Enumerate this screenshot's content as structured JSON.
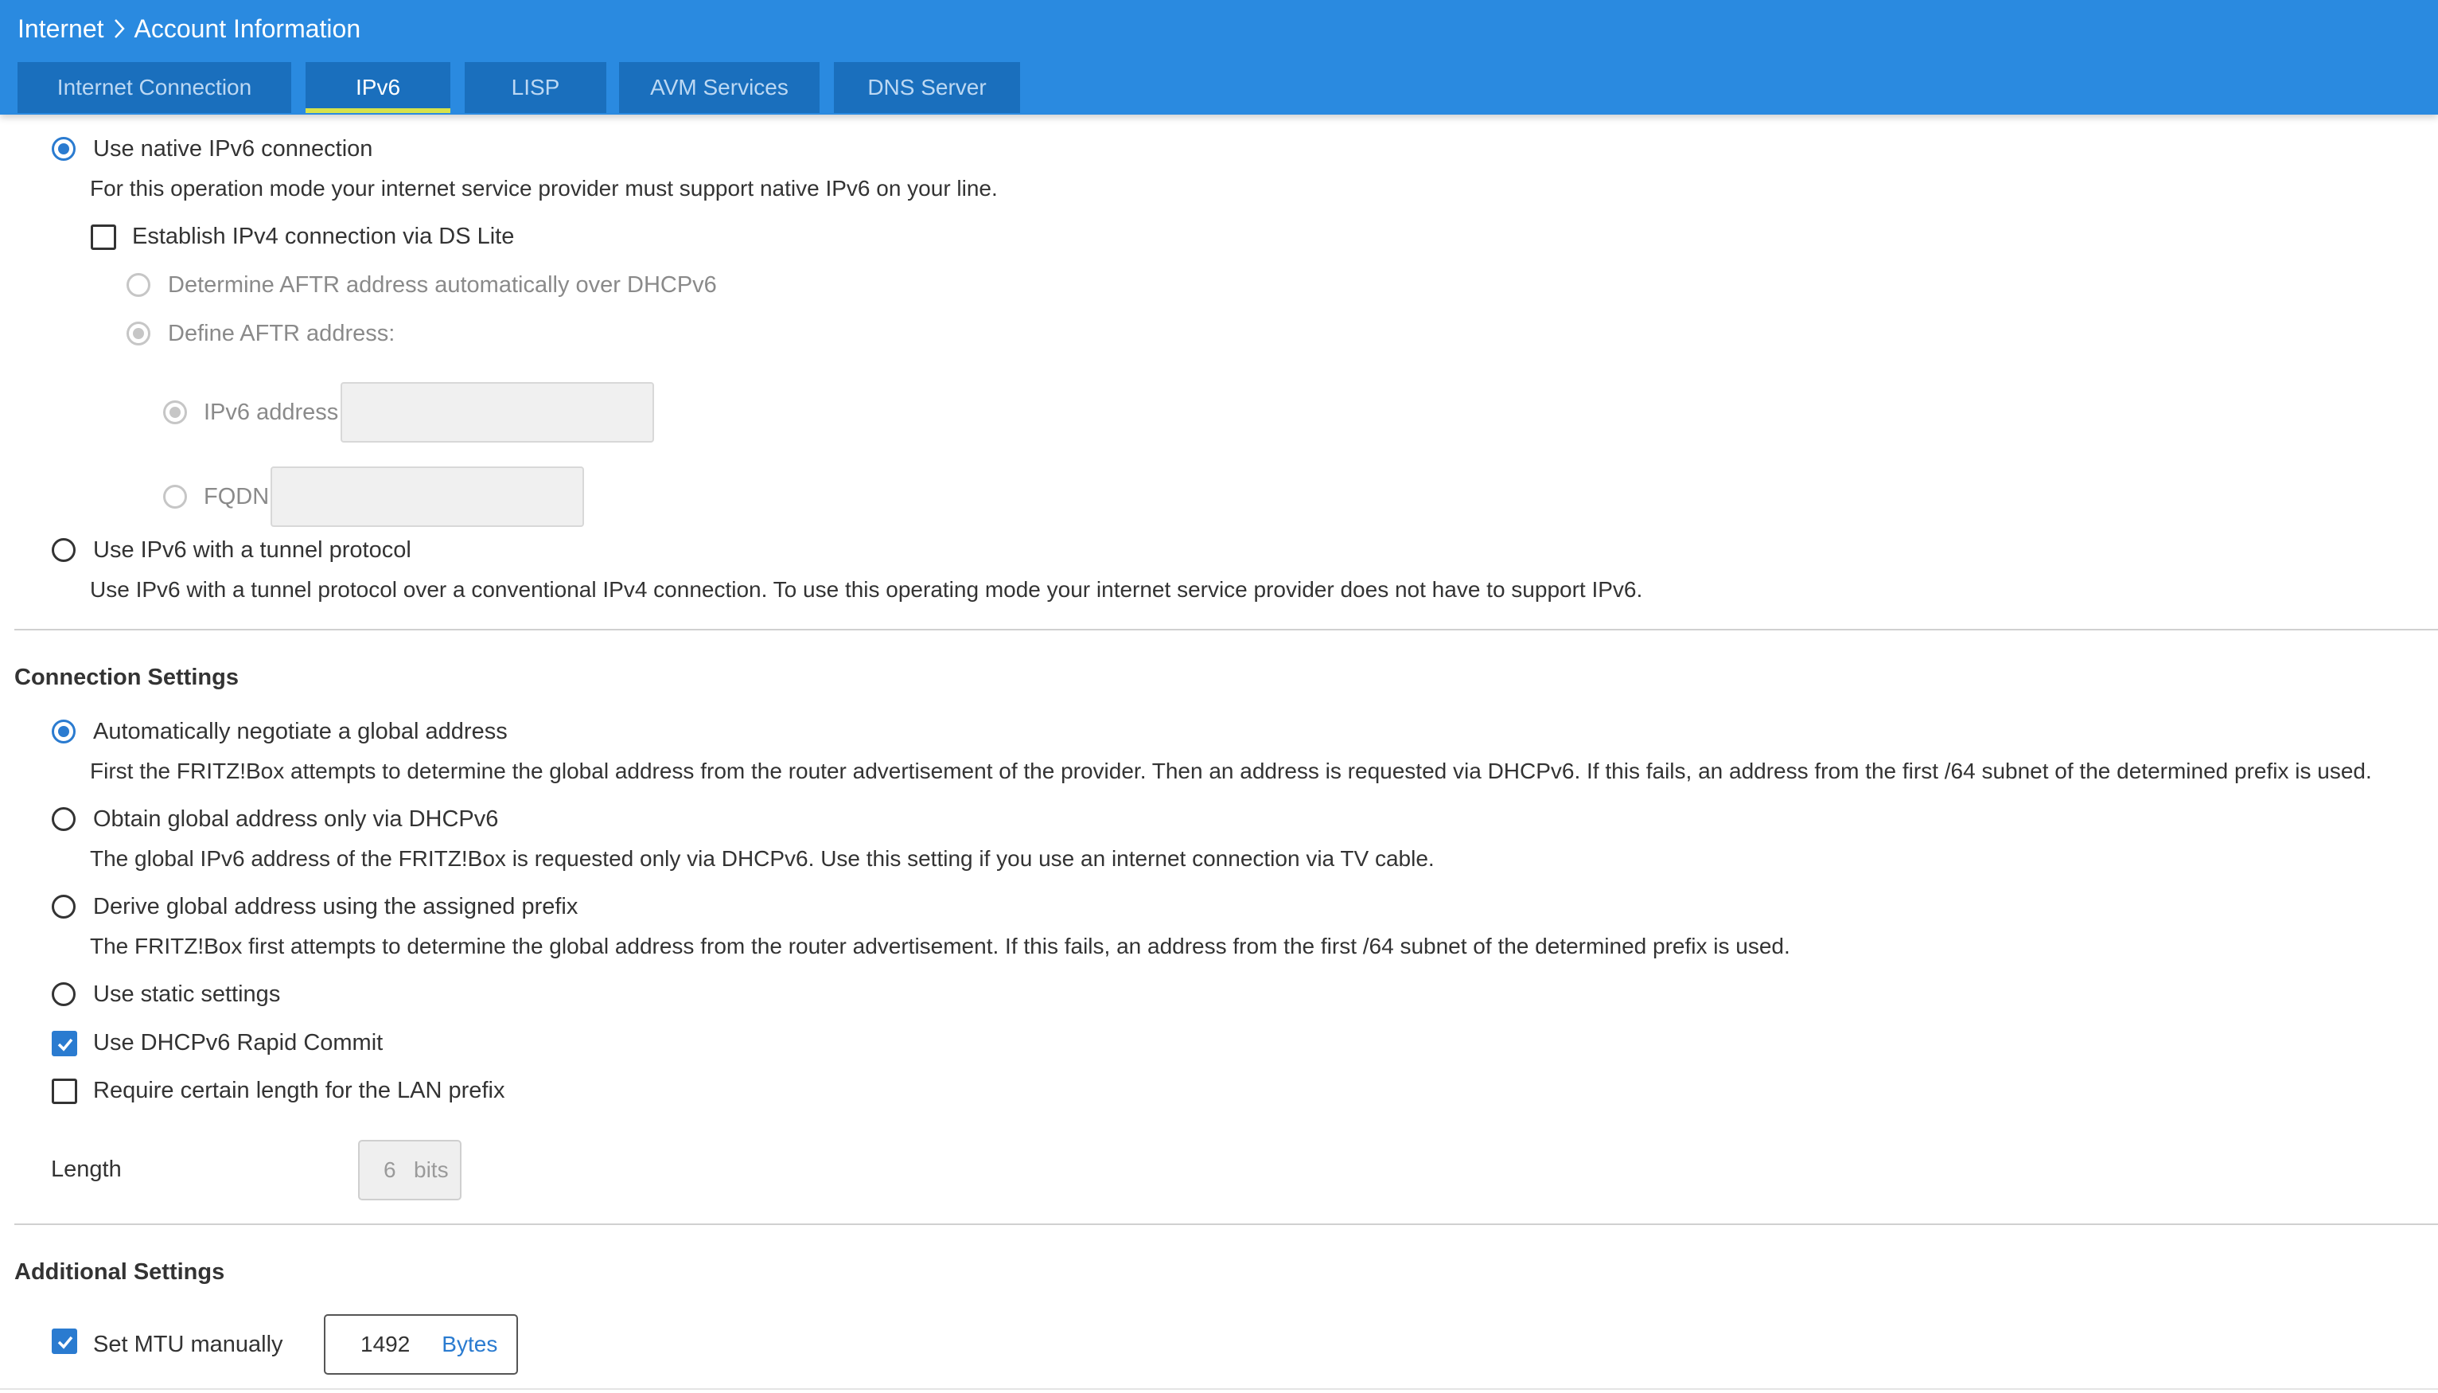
{
  "breadcrumb": {
    "parent": "Internet",
    "current": "Account Information"
  },
  "tabs": [
    {
      "label": "Internet Connection",
      "active": false
    },
    {
      "label": "IPv6",
      "active": true
    },
    {
      "label": "LISP",
      "active": false
    },
    {
      "label": "AVM Services",
      "active": false
    },
    {
      "label": "DNS Server",
      "active": false
    }
  ],
  "mode": {
    "native_label": "Use native IPv6 connection",
    "native_checked": true,
    "native_desc": "For this operation mode your internet service provider must support native IPv6 on your line.",
    "dslite_label": "Establish IPv4 connection via DS Lite",
    "dslite_checked": false,
    "aftr_auto_label": "Determine AFTR address automatically over DHCPv6",
    "aftr_define_label": "Define AFTR address:",
    "ipv6_address_label": "IPv6 address",
    "ipv6_address_value": "",
    "fqdn_label": "FQDN",
    "fqdn_value": "",
    "tunnel_label": "Use IPv6 with a tunnel protocol",
    "tunnel_checked": false,
    "tunnel_desc": "Use IPv6 with a tunnel protocol over a conventional IPv4 connection. To use this operating mode your internet service provider does not have to support IPv6."
  },
  "connection_settings": {
    "title": "Connection Settings",
    "options": [
      {
        "label": "Automatically negotiate a global address",
        "checked": true,
        "desc": "First the FRITZ!Box attempts to determine the global address from the router advertisement of the provider. Then an address is requested via DHCPv6. If this fails, an address from the first /64 subnet of the determined prefix is used."
      },
      {
        "label": "Obtain global address only via DHCPv6",
        "checked": false,
        "desc": "The global IPv6 address of the FRITZ!Box is requested only via DHCPv6. Use this setting if you use an internet connection via TV cable."
      },
      {
        "label": "Derive global address using the assigned prefix",
        "checked": false,
        "desc": "The FRITZ!Box first attempts to determine the global address from the router advertisement. If this fails, an address from the first /64 subnet of the determined prefix is used."
      },
      {
        "label": "Use static settings",
        "checked": false
      }
    ],
    "rapid_commit_label": "Use DHCPv6 Rapid Commit",
    "rapid_commit_checked": true,
    "lan_prefix_label": "Require certain length for the LAN prefix",
    "lan_prefix_checked": false,
    "length_label": "Length",
    "length_value": "6",
    "length_unit": "bits"
  },
  "additional_settings": {
    "title": "Additional Settings",
    "mtu_label": "Set MTU manually",
    "mtu_checked": true,
    "mtu_value": "1492",
    "mtu_unit": "Bytes"
  },
  "colors": {
    "header": "#2a8ae0",
    "tab_bg": "#1a6fbd",
    "tab_active_underline": "#d7e24a",
    "accent": "#2a7bd0"
  }
}
